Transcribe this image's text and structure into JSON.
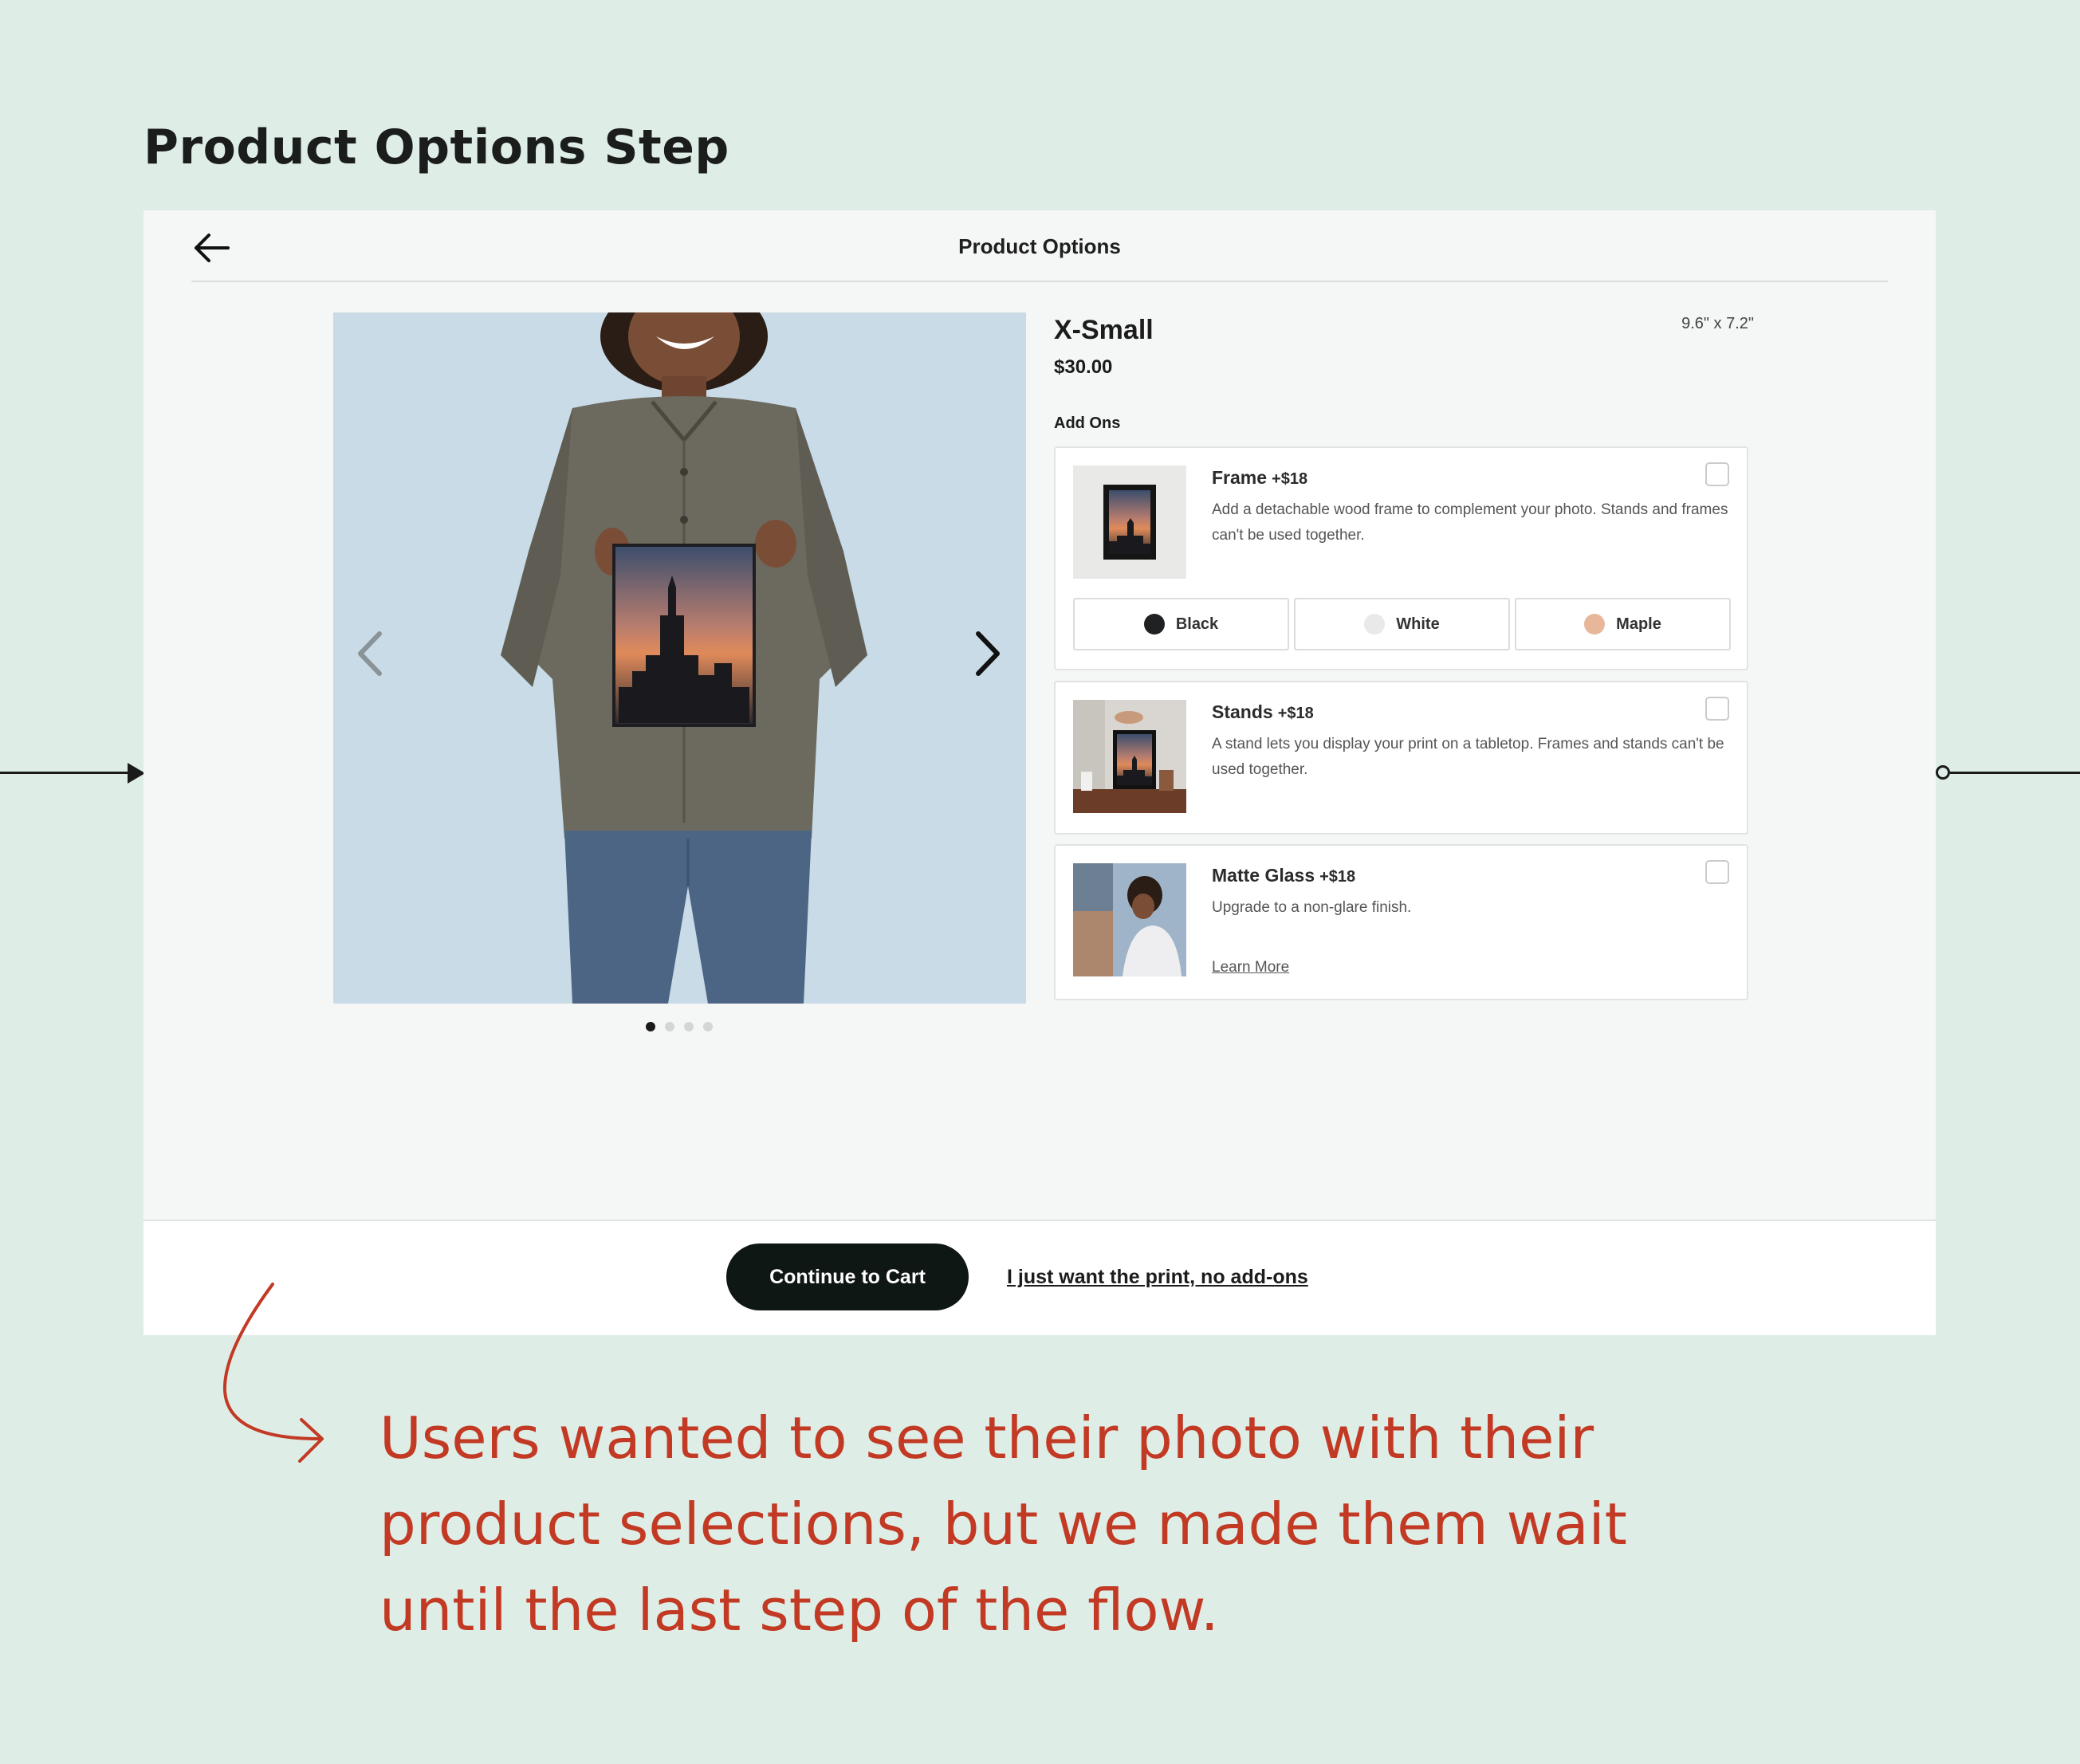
{
  "page": {
    "heading": "Product Options Step",
    "annotation": "Users wanted to see their photo with their product selections, but we made them wait until the last step of the flow."
  },
  "topbar": {
    "title": "Product Options"
  },
  "product": {
    "size": "X-Small",
    "dimensions": "9.6\" x 7.2\"",
    "price": "$30.00",
    "addons_heading": "Add Ons",
    "carousel_total": 4,
    "carousel_active": 1
  },
  "addons": [
    {
      "title": "Frame",
      "price": "+$18",
      "description": "Add a detachable wood frame to complement your photo. Stands and frames can't be used together.",
      "checked": false,
      "options": [
        {
          "label": "Black",
          "color": "#1f2123"
        },
        {
          "label": "White",
          "color": "#e9e9e9"
        },
        {
          "label": "Maple",
          "color": "#e8b79a"
        }
      ]
    },
    {
      "title": "Stands",
      "price": "+$18",
      "description": "A stand lets you display your print on a tabletop. Frames and stands can't be used together.",
      "checked": false
    },
    {
      "title": "Matte Glass",
      "price": "+$18",
      "description": "Upgrade to a non-glare finish.",
      "link": "Learn More",
      "checked": false
    }
  ],
  "footer": {
    "continue_label": "Continue to Cart",
    "no_addons_label": "I just want the print, no add-ons"
  },
  "colors": {
    "background": "#dfede7",
    "annotation": "#c23a24",
    "primary_button": "#0f1714"
  }
}
